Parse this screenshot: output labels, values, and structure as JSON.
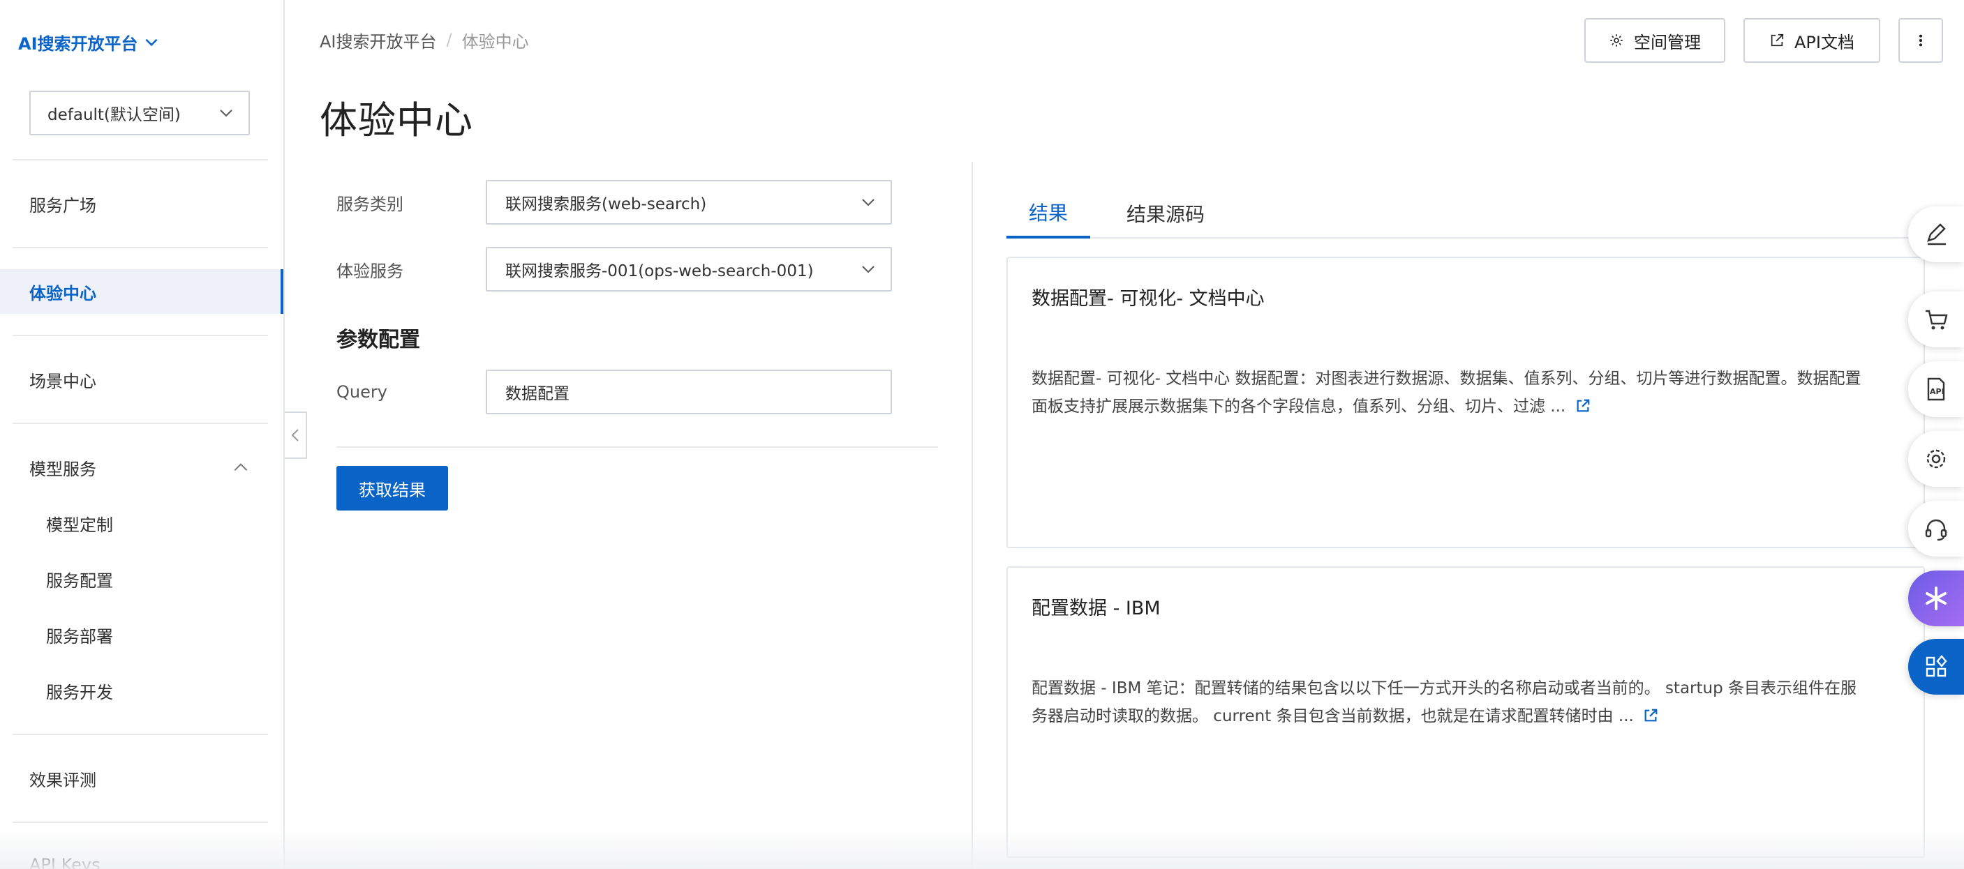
{
  "sidebar": {
    "brand": "AI搜索开放平台",
    "workspace": "default(默认空间)",
    "items": {
      "service_plaza": "服务广场",
      "experience_center": "体验中心",
      "scenario_center": "场景中心",
      "model_services": "模型服务",
      "model_custom": "模型定制",
      "service_config": "服务配置",
      "service_deploy": "服务部署",
      "service_dev": "服务开发",
      "evaluation": "效果评测",
      "api_keys": "API Keys"
    }
  },
  "header": {
    "breadcrumb_root": "AI搜索开放平台",
    "breadcrumb_sep": "/",
    "breadcrumb_current": "体验中心",
    "title": "体验中心",
    "space_mgmt": "空间管理",
    "api_docs": "API文档"
  },
  "form": {
    "service_type_label": "服务类别",
    "service_type_value": "联网搜索服务(web-search)",
    "experience_service_label": "体验服务",
    "experience_service_value": "联网搜索服务-001(ops-web-search-001)",
    "params_title": "参数配置",
    "query_label": "Query",
    "query_value": "数据配置",
    "submit": "获取结果"
  },
  "results": {
    "tab_result": "结果",
    "tab_source": "结果源码",
    "cards": [
      {
        "title": "数据配置- 可视化- 文档中心",
        "line1": "数据配置- 可视化- 文档中心 数据配置：对图表进行数据源、数据集、值系列、分组、切片等进行数据配置。数据配置",
        "line2": "面板支持扩展展示数据集下的各个字段信息，值系列、分组、切片、过滤 ..."
      },
      {
        "title": "配置数据 - IBM",
        "line1": "配置数据 - IBM 笔记：配置转储的结果包含以以下任一方式开头的名称启动或者当前的。 startup 条目表示组件在服",
        "line2": "务器启动时读取的数据。 current 条目包含当前数据，也就是在请求配置转储时由 ..."
      }
    ]
  },
  "colors": {
    "primary": "#0a64c8",
    "border": "#cfd3d9",
    "active_bg": "#eef1f7"
  }
}
